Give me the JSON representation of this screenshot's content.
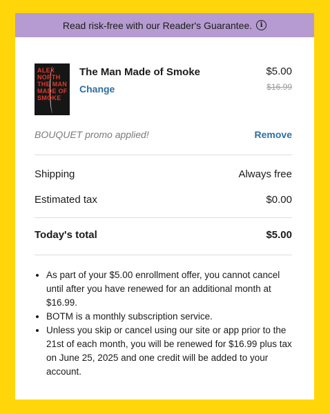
{
  "banner": {
    "text": "Read risk-free with our Reader's Guarantee.",
    "info_icon": "info-icon"
  },
  "product": {
    "cover_lines": [
      "ALEX",
      "NORTH",
      "THE MAN",
      "MADE OF",
      "SMOKE"
    ],
    "title": "The Man Made of Smoke",
    "change_label": "Change",
    "price": "$5.00",
    "original_price": "$16.99"
  },
  "promo": {
    "text": "BOUQUET promo applied!",
    "remove_label": "Remove"
  },
  "summary": {
    "shipping_label": "Shipping",
    "shipping_value": "Always free",
    "tax_label": "Estimated tax",
    "tax_value": "$0.00",
    "total_label": "Today's total",
    "total_value": "$5.00"
  },
  "terms": [
    "As part of your $5.00 enrollment offer, you cannot cancel until after you have renewed for an additional month at $16.99.",
    "BOTM is a monthly subscription service.",
    "Unless you skip or cancel using our site or app prior to the 21st of each month, you will be renewed for $16.99 plus tax on June 25, 2025 and one credit will be added to your account."
  ],
  "colors": {
    "background": "#FFD60A",
    "banner": "#B59BD1",
    "link": "#2d6ea3"
  }
}
